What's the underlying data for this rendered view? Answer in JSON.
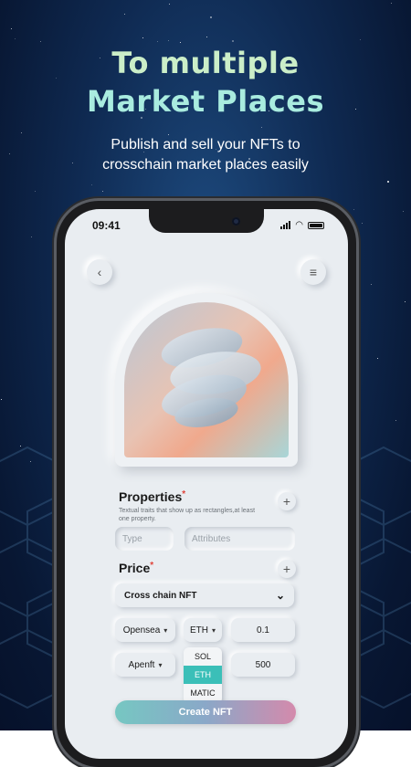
{
  "headline": {
    "line1": "To multiple",
    "line2": "Market Places"
  },
  "subtitle": {
    "line1": "Publish and sell your NFTs to",
    "line2": "crosschain market places easily"
  },
  "status_bar": {
    "time": "09:41"
  },
  "nav": {
    "back_icon": "chevron-left-icon",
    "menu_icon": "menu-icon"
  },
  "properties": {
    "title": "Properties",
    "required_mark": "*",
    "hint": "Textual traits that show up as rectangles,at least one property.",
    "type_placeholder": "Type",
    "attributes_placeholder": "Attributes"
  },
  "price": {
    "title": "Price",
    "required_mark": "*",
    "mode": "Cross chain NFT",
    "rows": [
      {
        "market": "Opensea",
        "currency": "ETH",
        "amount": "0.1"
      },
      {
        "market": "Apenft",
        "currency": "",
        "amount": "500"
      }
    ],
    "currency_options": [
      "SOL",
      "ETH",
      "MATIC"
    ],
    "selected_currency": "ETH"
  },
  "create_button": "Create NFT",
  "colors": {
    "accent": "#3bbfb8",
    "button_start": "#76c7c2",
    "button_end": "#d48aac",
    "background": "#0f2a52"
  }
}
